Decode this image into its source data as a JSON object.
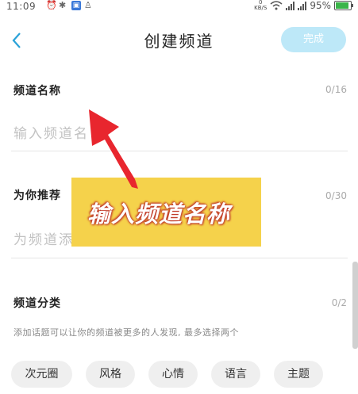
{
  "status_bar": {
    "time": "11:09",
    "network_speed": "0\nKB/S",
    "battery": "95%"
  },
  "header": {
    "back_icon": "chevron-left",
    "title": "创建频道",
    "done_label": "完成"
  },
  "name_section": {
    "label": "频道名称",
    "count": "0/16",
    "placeholder": "输入频道名"
  },
  "recommend_section": {
    "label": "为你推荐",
    "count": "0/30",
    "placeholder": "为频道添"
  },
  "category_section": {
    "label": "频道分类",
    "count": "0/2",
    "hint": "添加话题可以让你的频道被更多的人发现, 最多选择两个",
    "tags": [
      "次元圈",
      "风格",
      "心情",
      "语言",
      "主题"
    ]
  },
  "overlay": {
    "text": "输入频道名称",
    "background_color": "#f5d24b",
    "arrow_color": "#e8262e"
  },
  "colors": {
    "accent": "#2aa2d8",
    "done_disabled": "#bde8f8"
  }
}
